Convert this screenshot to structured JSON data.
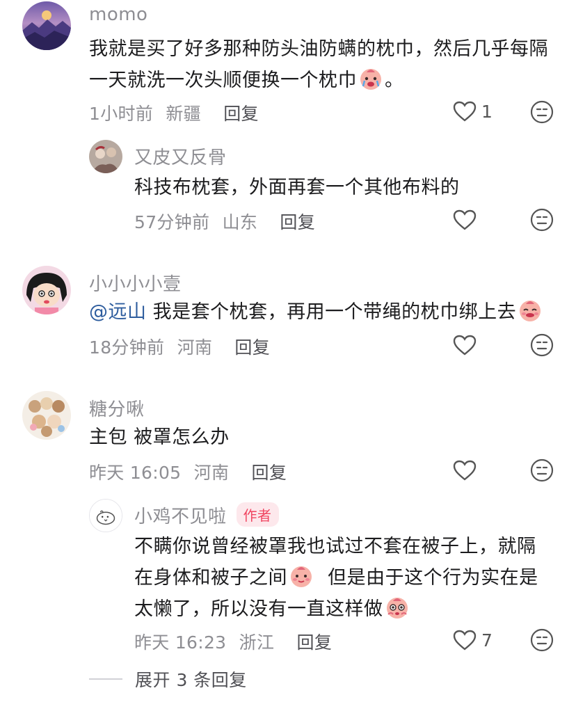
{
  "comments": [
    {
      "username": "momo",
      "lines": [
        "我就是买了好多那种防头油防螨的枕巾，然后几乎每隔",
        "一天就洗一次头顺便换一个枕巾"
      ],
      "line2_suffix": "。",
      "time": "1小时前",
      "location": "新疆",
      "reply_label": "回复",
      "likes": "1",
      "avatar_icon": "mountain-landscape-avatar"
    },
    {
      "username": "又皮又反骨",
      "lines": [
        "科技布枕套，外面再套一个其他布料的"
      ],
      "time": "57分钟前",
      "location": "山东",
      "reply_label": "回复",
      "likes": "",
      "avatar_icon": "photo-avatar"
    },
    {
      "username": "小小小小壹",
      "mention": "@远山",
      "lines": [
        " 我是套个枕套，再用一个带绳的枕巾绑上去"
      ],
      "time": "18分钟前",
      "location": "河南",
      "reply_label": "回复",
      "likes": "",
      "avatar_icon": "cartoon-girl-avatar"
    },
    {
      "username": "糖分啾",
      "lines": [
        "主包 被罩怎么办"
      ],
      "time": "昨天 16:05",
      "location": "河南",
      "reply_label": "回复",
      "likes": "",
      "avatar_icon": "teddy-bears-avatar"
    },
    {
      "username": "小鸡不见啦",
      "author_tag": "作者",
      "lines": [
        "不瞒你说曾经被罩我也试过不套在被子上，就隔",
        "在身体和被子之间",
        "  但是由于这个行为实在是",
        "太懒了，所以没有一直这样做"
      ],
      "time": "昨天 16:23",
      "location": "浙江",
      "reply_label": "回复",
      "likes": "7",
      "avatar_icon": "chick-avatar"
    }
  ],
  "expand_label": "展开 3 条回复",
  "colors": {
    "muted": "#8e8e93",
    "mention": "#2e5d9e",
    "author_tag": "#f04561",
    "author_tag_bg": "#fde8ec"
  }
}
